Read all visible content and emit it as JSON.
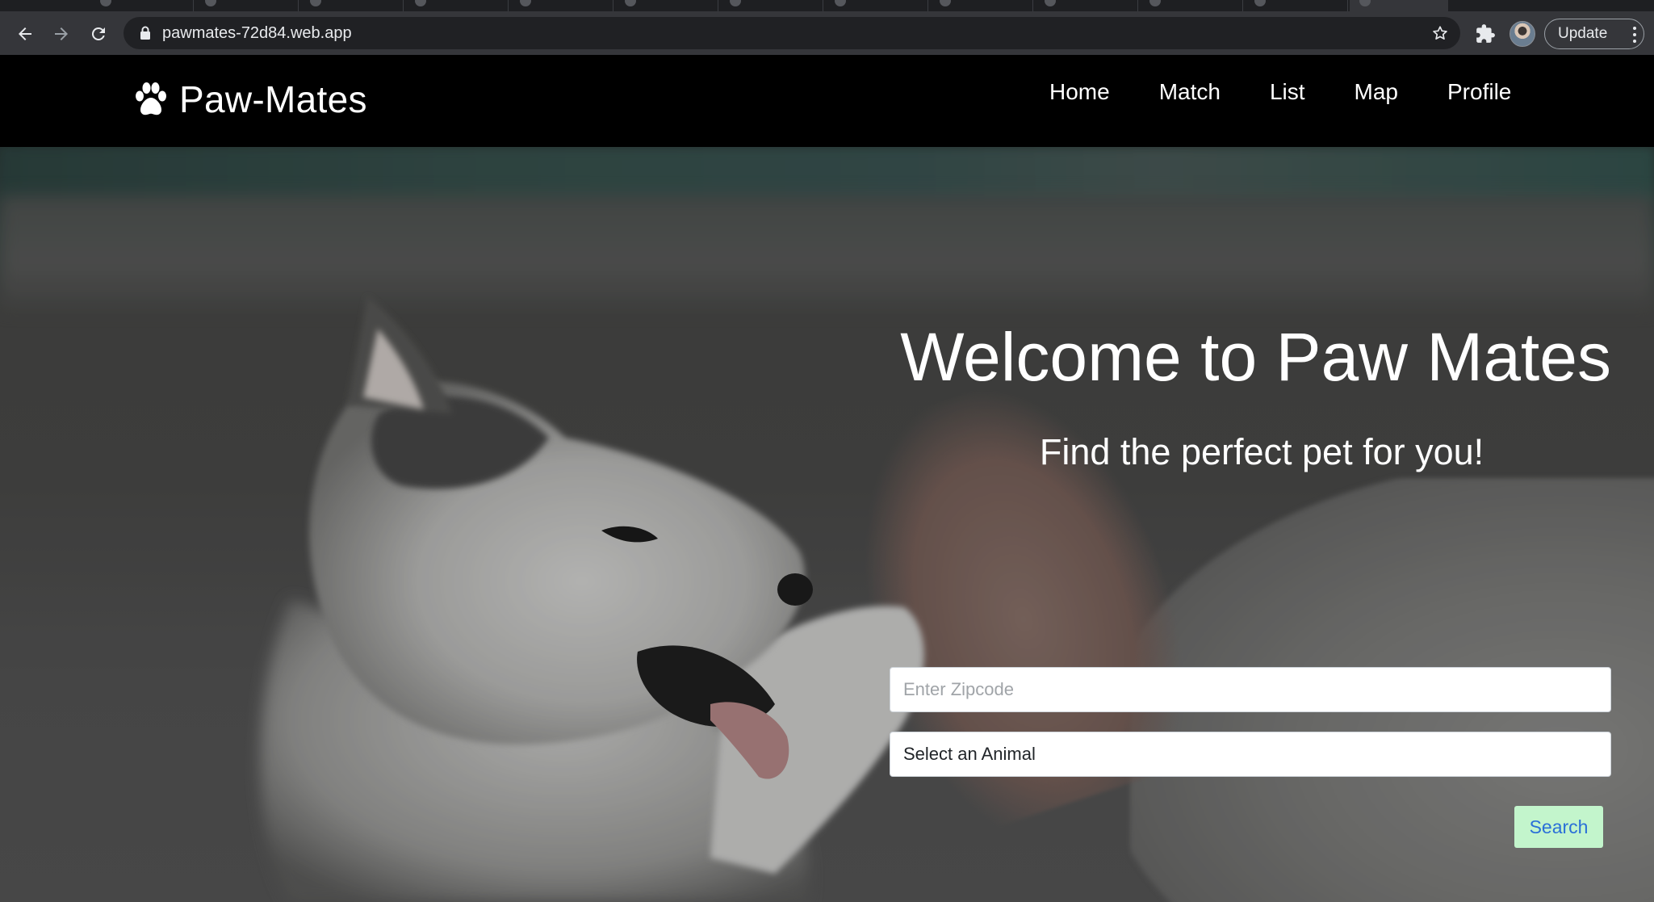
{
  "browser": {
    "url": "pawmates-72d84.web.app",
    "update_label": "Update"
  },
  "site": {
    "brand": "Paw-Mates",
    "nav": [
      {
        "label": "Home"
      },
      {
        "label": "Match"
      },
      {
        "label": "List"
      },
      {
        "label": "Map"
      },
      {
        "label": "Profile"
      }
    ]
  },
  "hero": {
    "title": "Welcome to Paw Mates",
    "subtitle": "Find the perfect pet for you!",
    "zip_placeholder": "Enter Zipcode",
    "zip_value": "",
    "animal_select": "Select an Animal",
    "search_label": "Search"
  },
  "colors": {
    "nav_bg": "#000000",
    "search_button_bg": "#c3f5cc",
    "search_button_text": "#2a6fd8"
  },
  "icons": {
    "back": "arrow-left-icon",
    "forward": "arrow-right-icon",
    "reload": "reload-icon",
    "lock": "lock-icon",
    "bookmark": "star-icon",
    "extensions": "puzzle-icon",
    "brand": "paw-icon",
    "menu": "kebab-menu-icon"
  }
}
